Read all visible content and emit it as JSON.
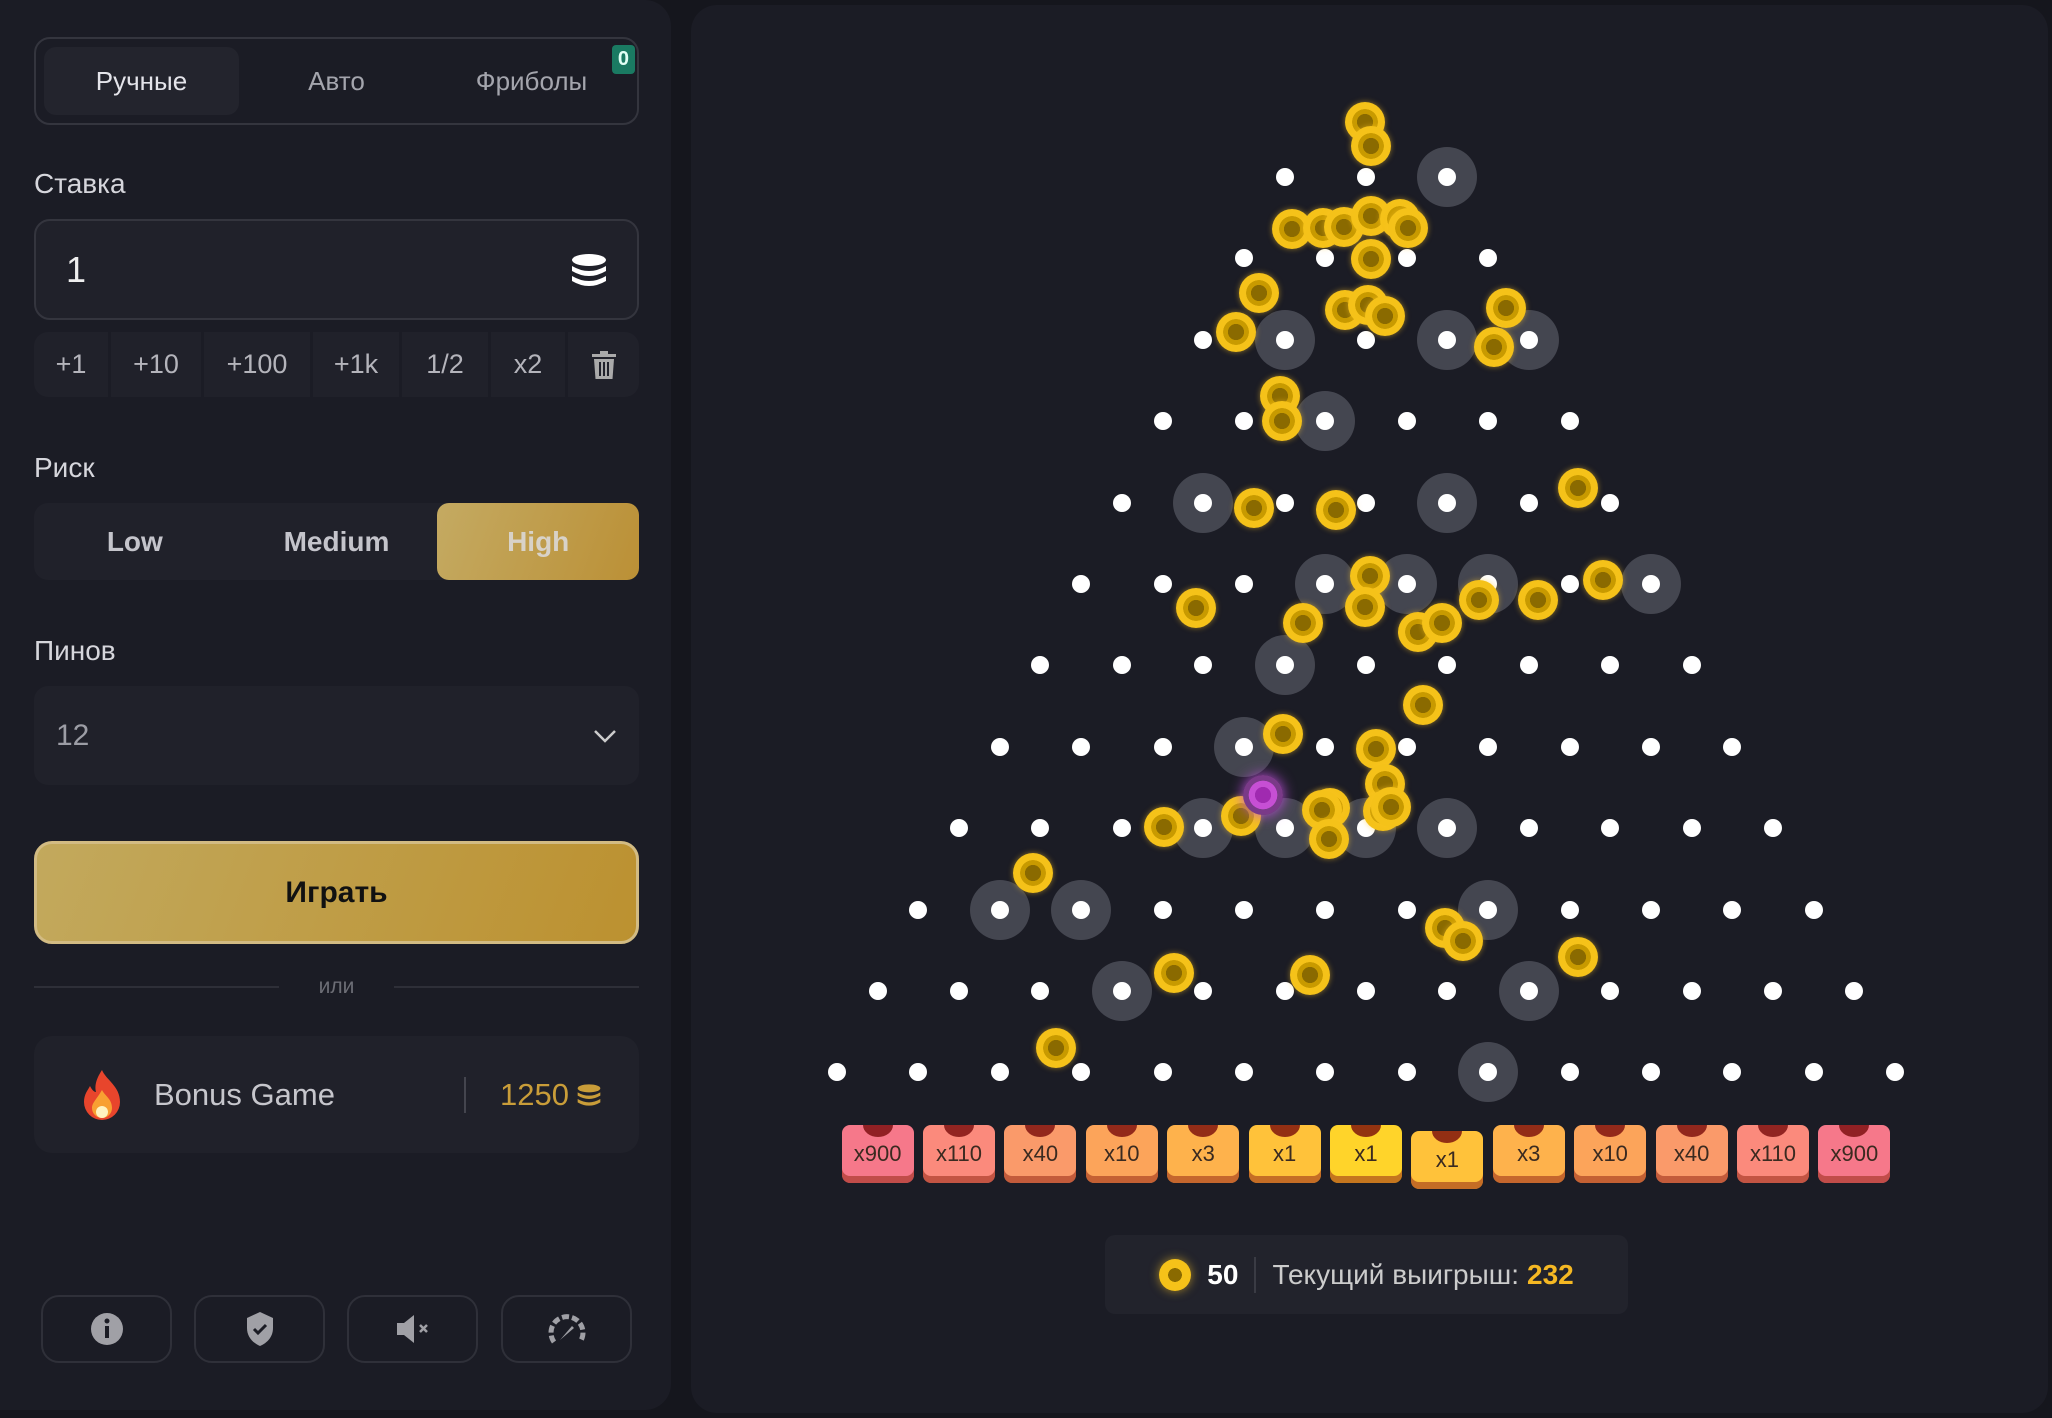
{
  "tabs": [
    {
      "label": "Ручные",
      "active": true
    },
    {
      "label": "Авто"
    },
    {
      "label": "Фриболы",
      "badge": "0"
    }
  ],
  "bet": {
    "label": "Ставка",
    "value": "1",
    "icon": "coins-stack-icon"
  },
  "quick_buttons": [
    "+1",
    "+10",
    "+100",
    "+1k",
    "1/2",
    "x2"
  ],
  "risk": {
    "label": "Риск",
    "options": [
      "Low",
      "Medium",
      "High"
    ],
    "selected": "High"
  },
  "pins": {
    "label": "Пинов",
    "value": "12"
  },
  "play_label": "Играть",
  "or_label": "или",
  "bonus": {
    "title": "Bonus Game",
    "value": "1250"
  },
  "footer_icons": [
    "info-icon",
    "shield-check-icon",
    "sound-muted-icon",
    "speedometer-icon"
  ],
  "board": {
    "rows": 12,
    "multipliers": [
      "x900",
      "x110",
      "x40",
      "x10",
      "x3",
      "x1",
      "x1",
      "x1",
      "x3",
      "x10",
      "x40",
      "x110",
      "x900"
    ],
    "bucket_colors": [
      "#f6788a",
      "#fb8a7c",
      "#fa9a6a",
      "#fca45a",
      "#feb24c",
      "#ffc23a",
      "#ffd42a",
      "#ffc23a",
      "#feb24c",
      "#fca45a",
      "#fa9a6a",
      "#fb8a7c",
      "#f6788a"
    ]
  },
  "stats": {
    "balls": "50",
    "win_label": "Текущий выигрыш:",
    "win_value": "232"
  },
  "colors": {
    "accent": "#c4a04a",
    "win": "#f5b823",
    "badge": "#1a7a62"
  }
}
